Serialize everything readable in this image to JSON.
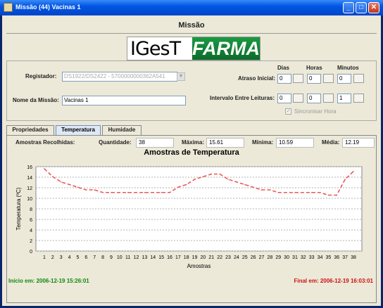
{
  "window": {
    "title": "Missão (44) Vacinas 1"
  },
  "heading": "Missão",
  "logo": {
    "part1": "IGesT",
    "part2": "FARMA"
  },
  "form": {
    "registador_label": "Registador:",
    "registador_value": "DS1922/DS2422 - 5700000000362A541",
    "nome_label": "Nome da Missão:",
    "nome_value": "Vacinas 1",
    "col_dias": "Dias",
    "col_horas": "Horas",
    "col_minutos": "Minutos",
    "atraso_label": "Atraso Inicial:",
    "atraso": {
      "dias": "0",
      "horas": "0",
      "minutos": "0"
    },
    "intervalo_label": "Intervalo Entre Leituras:",
    "intervalo": {
      "dias": "0",
      "horas": "0",
      "minutos": "1"
    },
    "sincronizar_label": "Sincronisar Hora"
  },
  "tabs": [
    {
      "label": "Propriedades"
    },
    {
      "label": "Temperatura"
    },
    {
      "label": "Humidade"
    }
  ],
  "stats": {
    "amostras_label": "Amostras Recolhidas:",
    "quantidade_label": "Quantidade:",
    "quantidade": "38",
    "maxima_label": "Máxima:",
    "maxima": "15.61",
    "minima_label": "Mínima:",
    "minima": "10.59",
    "media_label": "Média:",
    "media": "12.19"
  },
  "chart_data": {
    "type": "line",
    "title": "Amostras de Temperatura",
    "xlabel": "Amostras",
    "ylabel": "Temperatura (ºC)",
    "ylim": [
      0,
      16
    ],
    "yticks": [
      0,
      2,
      4,
      6,
      8,
      10,
      12,
      14,
      16
    ],
    "grid": true,
    "series": [
      {
        "color": "#e85858",
        "x": [
          1,
          2,
          3,
          4,
          5,
          6,
          7,
          8,
          9,
          10,
          11,
          12,
          13,
          14,
          15,
          16,
          17,
          18,
          19,
          20,
          21,
          22,
          23,
          24,
          25,
          26,
          27,
          28,
          29,
          30,
          31,
          32,
          33,
          34,
          35,
          36,
          37,
          38
        ],
        "values": [
          15.6,
          14.1,
          13.1,
          12.6,
          12.1,
          11.6,
          11.6,
          11.1,
          11.1,
          11.1,
          11.1,
          11.1,
          11.1,
          11.1,
          11.1,
          11.1,
          12.1,
          12.6,
          13.6,
          14.1,
          14.6,
          14.6,
          13.6,
          13.1,
          12.6,
          12.1,
          11.6,
          11.6,
          11.1,
          11.1,
          11.1,
          11.1,
          11.1,
          11.1,
          10.6,
          10.6,
          13.6,
          15.1
        ]
      }
    ]
  },
  "footer": {
    "inicio": "Início em: 2006-12-19 15:26:01",
    "final": "Final em: 2006-12-19 16:03:01"
  }
}
